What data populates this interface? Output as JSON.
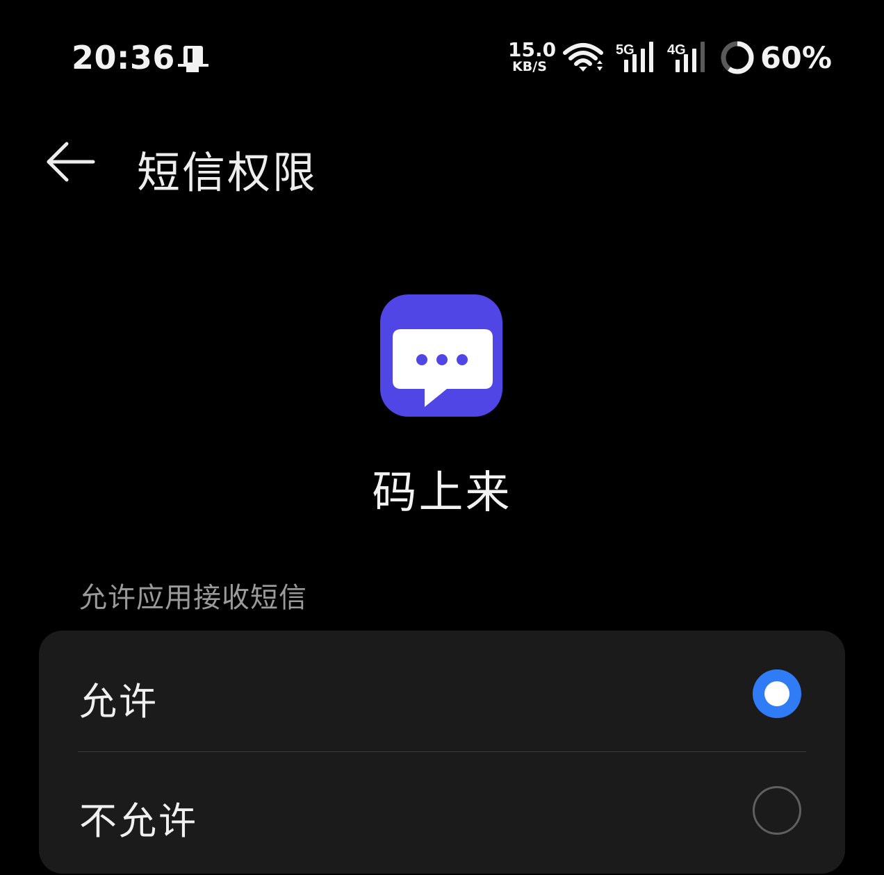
{
  "status_bar": {
    "time": "20:36",
    "net_speed_value": "15.0",
    "net_speed_unit": "KB/S",
    "signal_1_label": "5G",
    "signal_2_label": "4G",
    "battery": "60%",
    "battery_level": 0.6,
    "icons": [
      "phone-status-icon",
      "wifi-icon",
      "signal-5g-icon",
      "signal-4g-icon",
      "battery-ring-icon"
    ]
  },
  "header": {
    "back_icon": "back-arrow-icon",
    "title": "短信权限"
  },
  "app": {
    "name": "码上来",
    "icon": "chat-bubble-icon",
    "icon_color": "#5046e5"
  },
  "permission": {
    "section_label": "允许应用接收短信",
    "options": [
      {
        "label": "允许",
        "selected": true
      },
      {
        "label": "不允许",
        "selected": false
      }
    ],
    "accent_color": "#2f7cf6"
  }
}
